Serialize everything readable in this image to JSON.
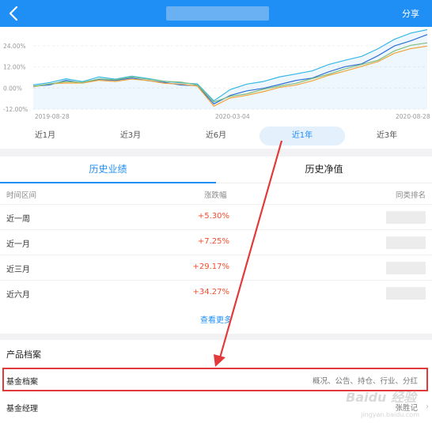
{
  "header": {
    "share_label": "分享"
  },
  "chart_data": {
    "type": "line",
    "y_ticks": [
      "24.00%",
      "12.00%",
      "0.00%",
      "-12.00%"
    ],
    "x_ticks": [
      "2019-08-28",
      "2020-03-04",
      "2020-08-28"
    ],
    "ylim": [
      -12,
      32
    ],
    "grid": true,
    "series": [
      {
        "color": "#2f6fd6",
        "values": [
          1,
          2,
          4,
          3,
          5,
          4,
          6,
          4,
          3,
          2,
          1,
          -9,
          -4,
          -2,
          0,
          2,
          4,
          6,
          9,
          12,
          14,
          18,
          24,
          27,
          30
        ]
      },
      {
        "color": "#36b8e8",
        "values": [
          2,
          3,
          5,
          4,
          6,
          5,
          7,
          5,
          4,
          3,
          2,
          -7,
          -1,
          2,
          4,
          6,
          8,
          10,
          13,
          16,
          18,
          22,
          28,
          31,
          33
        ]
      },
      {
        "color": "#f0a33c",
        "values": [
          1,
          2,
          3,
          3,
          4,
          4,
          5,
          4,
          3,
          2,
          1,
          -10,
          -6,
          -4,
          -2,
          0,
          2,
          4,
          7,
          10,
          12,
          15,
          20,
          22,
          24
        ]
      },
      {
        "color": "#7fbf7a",
        "values": [
          1,
          2,
          4,
          3,
          5,
          5,
          6,
          5,
          4,
          3,
          2,
          -8,
          -5,
          -3,
          -1,
          1,
          3,
          5,
          8,
          11,
          13,
          16,
          21,
          24,
          26
        ]
      }
    ]
  },
  "periods": [
    {
      "label": "近1月",
      "active": false
    },
    {
      "label": "近3月",
      "active": false
    },
    {
      "label": "近6月",
      "active": false
    },
    {
      "label": "近1年",
      "active": true
    },
    {
      "label": "近3年",
      "active": false
    }
  ],
  "tabs": {
    "performance": "历史业绩",
    "nav": "历史净值"
  },
  "table": {
    "headers": {
      "interval": "时间区间",
      "change": "涨跌幅",
      "rank": "同类排名"
    },
    "rows": [
      {
        "period": "近一周",
        "change": "+5.30%"
      },
      {
        "period": "近一月",
        "change": "+7.25%"
      },
      {
        "period": "近三月",
        "change": "+29.17%"
      },
      {
        "period": "近六月",
        "change": "+34.27%"
      }
    ],
    "more_label": "查看更多"
  },
  "profile": {
    "title": "产品档案",
    "archive": {
      "label": "基金档案",
      "desc": "概况、公告、持仓、行业、分红"
    },
    "manager": {
      "label": "基金经理",
      "desc": "张胜记"
    }
  },
  "colors": {
    "accent": "#1f8ff5",
    "positive": "#f24d2f",
    "highlight": "#e23a3a"
  }
}
